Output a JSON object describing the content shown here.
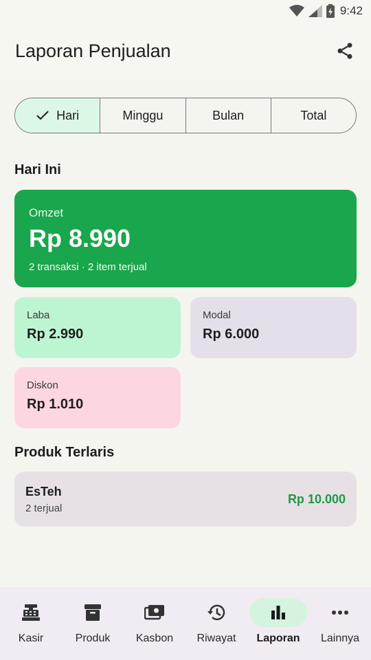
{
  "status_bar": {
    "time": "9:42",
    "icons": [
      "wifi-icon",
      "signal-icon",
      "battery-icon"
    ]
  },
  "app_bar": {
    "title": "Laporan Penjualan",
    "action_icon": "share-icon"
  },
  "period_tabs": [
    {
      "label": "Hari",
      "active": true
    },
    {
      "label": "Minggu",
      "active": false
    },
    {
      "label": "Bulan",
      "active": false
    },
    {
      "label": "Total",
      "active": false
    }
  ],
  "today": {
    "title": "Hari Ini",
    "omzet": {
      "label": "Omzet",
      "value": "Rp 8.990",
      "sub": "2 transaksi · 2 item terjual"
    },
    "laba": {
      "label": "Laba",
      "value": "Rp 2.990"
    },
    "modal": {
      "label": "Modal",
      "value": "Rp 6.000"
    },
    "diskon": {
      "label": "Diskon",
      "value": "Rp 1.010"
    }
  },
  "best_sellers": {
    "title": "Produk Terlaris",
    "items": [
      {
        "name": "EsTeh",
        "sold": "2 terjual",
        "total": "Rp 10.000"
      }
    ]
  },
  "bottom_nav": [
    {
      "label": "Kasir",
      "icon": "cash-register-icon",
      "active": false
    },
    {
      "label": "Produk",
      "icon": "archive-box-icon",
      "active": false
    },
    {
      "label": "Kasbon",
      "icon": "payments-icon",
      "active": false
    },
    {
      "label": "Riwayat",
      "icon": "history-icon",
      "active": false
    },
    {
      "label": "Laporan",
      "icon": "bar-chart-icon",
      "active": true
    },
    {
      "label": "Lainnya",
      "icon": "more-horizontal-icon",
      "active": false
    }
  ],
  "colors": {
    "primary_green": "#1aa64c",
    "laba_bg": "#bdf5d2",
    "modal_bg": "#e5dfea",
    "diskon_bg": "#fdd7e0",
    "price_green": "#1d9a49"
  }
}
